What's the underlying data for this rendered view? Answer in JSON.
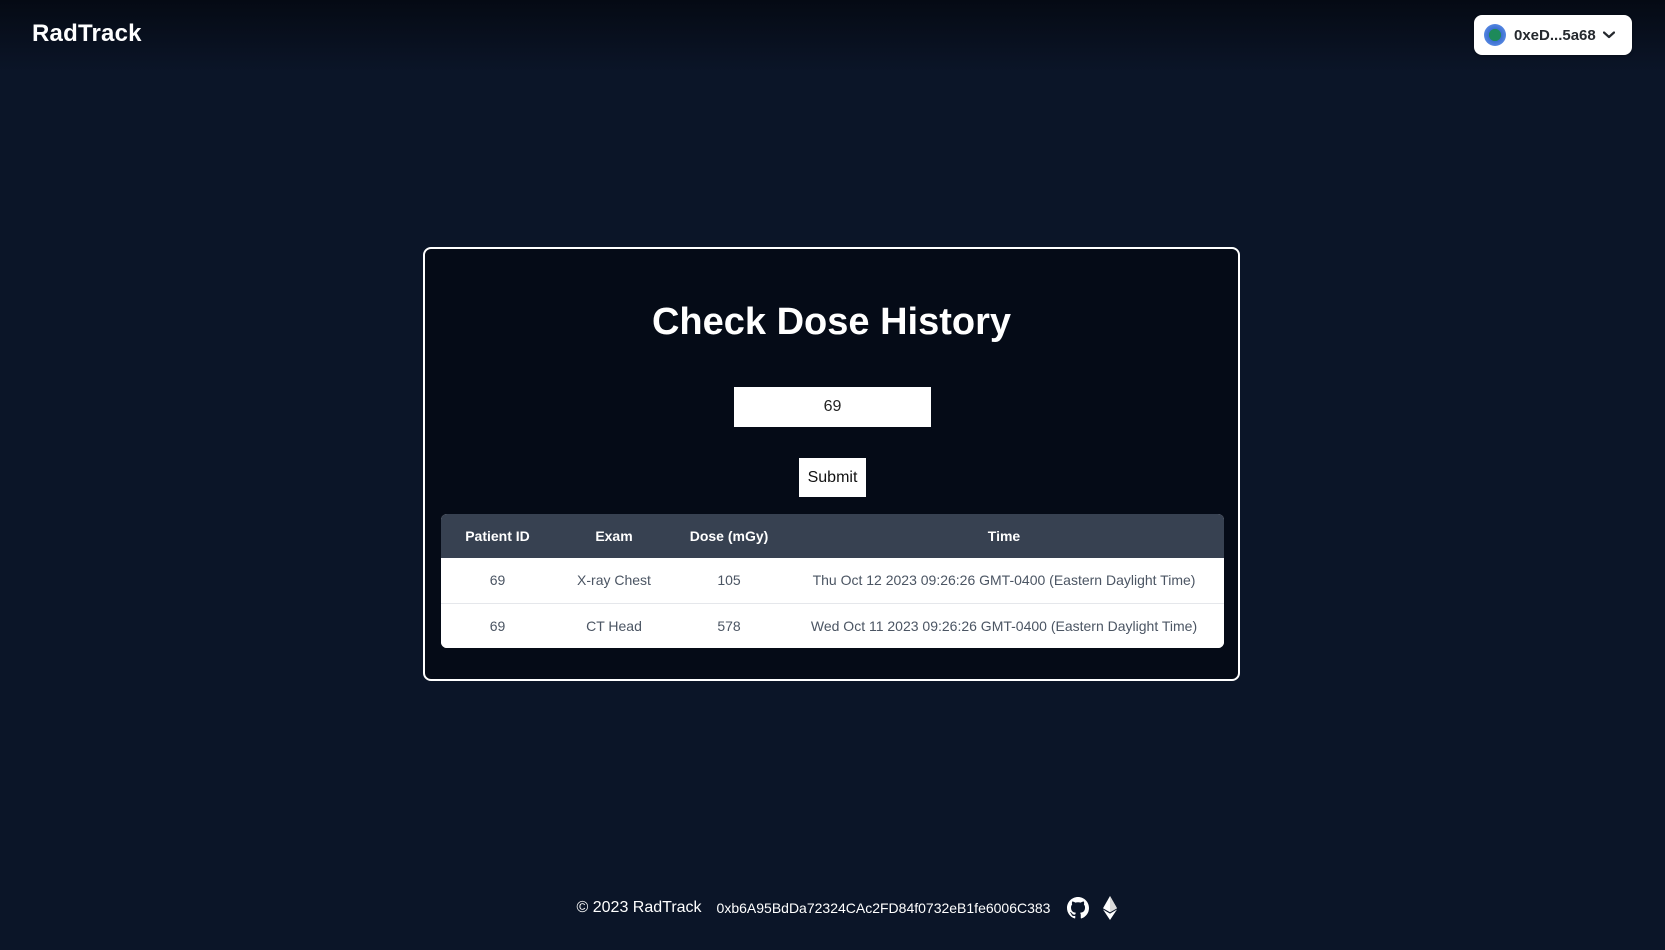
{
  "header": {
    "brand": "RadTrack",
    "wallet": {
      "address": "0xeD...5a68",
      "avatar_icon": "wallet-avatar-icon",
      "chevron_icon": "chevron-down-icon"
    }
  },
  "main": {
    "title": "Check Dose History",
    "patient_input": {
      "value": "69",
      "placeholder": ""
    },
    "submit_label": "Submit",
    "table": {
      "columns": [
        "Patient ID",
        "Exam",
        "Dose (mGy)",
        "Time"
      ],
      "rows": [
        {
          "patient_id": "69",
          "exam": "X-ray Chest",
          "dose": "105",
          "time": "Thu Oct 12 2023 09:26:26 GMT-0400 (Eastern Daylight Time)"
        },
        {
          "patient_id": "69",
          "exam": "CT Head",
          "dose": "578",
          "time": "Wed Oct 11 2023 09:26:26 GMT-0400 (Eastern Daylight Time)"
        }
      ]
    }
  },
  "footer": {
    "copyright": "© 2023 RadTrack",
    "contract_address": "0xb6A95BdDa72324CAc2FD84f0732eB1fe6006C383",
    "icons": [
      "github-icon",
      "ethereum-icon"
    ]
  },
  "colors": {
    "background": "#0b1528",
    "card_background": "#050b17",
    "table_header": "#374151",
    "table_text": "#4b5563",
    "white": "#ffffff"
  }
}
